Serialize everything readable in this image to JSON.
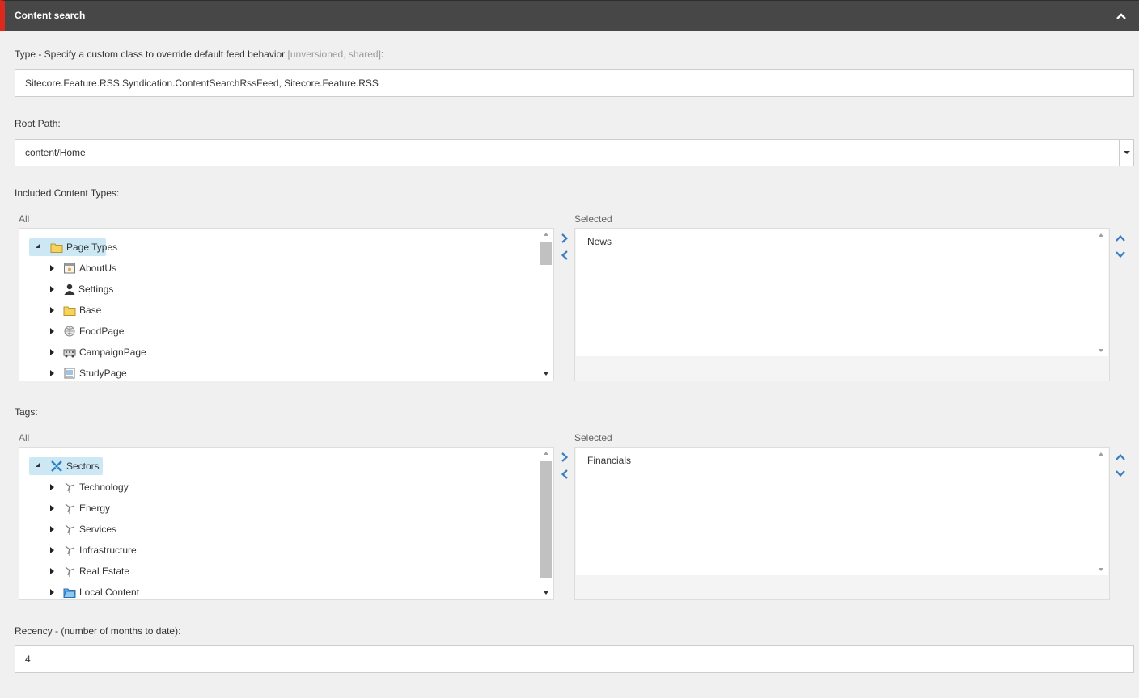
{
  "section": {
    "title": "Content search"
  },
  "type_field": {
    "label": "Type - Specify a custom class to override default feed behavior ",
    "meta": "[unversioned, shared]",
    "suffix": ":",
    "value": "Sitecore.Feature.RSS.Syndication.ContentSearchRssFeed, Sitecore.Feature.RSS"
  },
  "root_path": {
    "label": "Root Path:",
    "value": "content/Home"
  },
  "content_types": {
    "label": "Included Content Types:",
    "all_label": "All",
    "selected_label": "Selected",
    "tree": [
      {
        "label": "Page Types",
        "icon": "folder-icon",
        "expanded": true,
        "selected": true
      },
      {
        "label": "AboutUs",
        "icon": "page-icon"
      },
      {
        "label": "Settings",
        "icon": "user-icon"
      },
      {
        "label": "Base",
        "icon": "folder-icon"
      },
      {
        "label": "FoodPage",
        "icon": "globe-icon"
      },
      {
        "label": "CampaignPage",
        "icon": "vehicle-icon"
      },
      {
        "label": "StudyPage",
        "icon": "document-icon"
      }
    ],
    "selected_items": [
      "News"
    ]
  },
  "tags": {
    "label": "Tags:",
    "all_label": "All",
    "selected_label": "Selected",
    "tree": [
      {
        "label": "Sectors",
        "icon": "sectors-icon",
        "expanded": true,
        "selected": true
      },
      {
        "label": "Technology",
        "icon": "windmill-icon"
      },
      {
        "label": "Energy",
        "icon": "windmill-icon"
      },
      {
        "label": "Services",
        "icon": "windmill-icon"
      },
      {
        "label": "Infrastructure",
        "icon": "windmill-icon"
      },
      {
        "label": "Real Estate",
        "icon": "windmill-icon"
      },
      {
        "label": "Local Content",
        "icon": "blue-folder-icon"
      }
    ],
    "selected_items": [
      "Financials"
    ]
  },
  "recency": {
    "label": "Recency - (number of months to date):",
    "value": "4"
  },
  "colors": {
    "header_bg": "#474747",
    "accent_red": "#dc291e",
    "arrow_blue": "#3b7dc4",
    "selection_bg": "#cde8f5"
  }
}
